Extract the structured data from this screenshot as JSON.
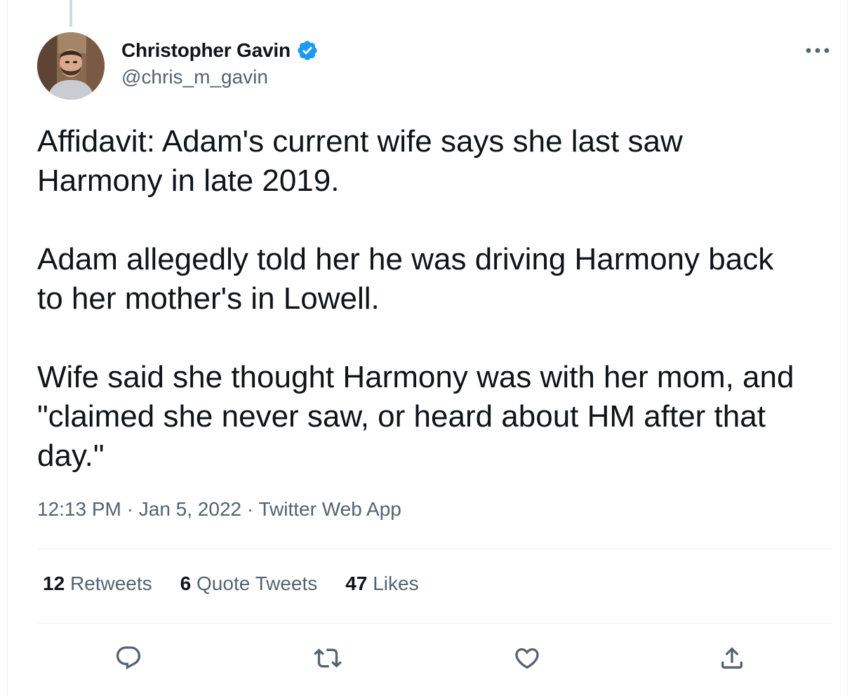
{
  "author": {
    "display_name": "Christopher Gavin",
    "handle": "@chris_m_gavin",
    "verified_icon": "verified-badge-icon"
  },
  "tweet": {
    "paragraphs": [
      [
        "Affidavit: Adam's current wife says she last saw",
        "Harmony in late 2019."
      ],
      [
        "Adam allegedly told her he was driving Harmony back",
        "to her mother's in Lowell."
      ],
      [
        "Wife said she thought Harmony was with her mom, and",
        "\"claimed she never saw, or heard about HM after that",
        "day.\""
      ]
    ],
    "time": "12:13 PM",
    "separator": " · ",
    "date": "Jan 5, 2022",
    "source": "Twitter Web App"
  },
  "stats": {
    "retweets": {
      "count": "12",
      "label": "Retweets"
    },
    "quotes": {
      "count": "6",
      "label": "Quote Tweets"
    },
    "likes": {
      "count": "47",
      "label": "Likes"
    }
  },
  "actions": [
    "reply-icon",
    "retweet-icon",
    "like-icon",
    "share-icon"
  ],
  "colors": {
    "text": "#0f1419",
    "secondary": "#536471",
    "verified": "#1d9bf0",
    "border": "#eff3f4"
  }
}
